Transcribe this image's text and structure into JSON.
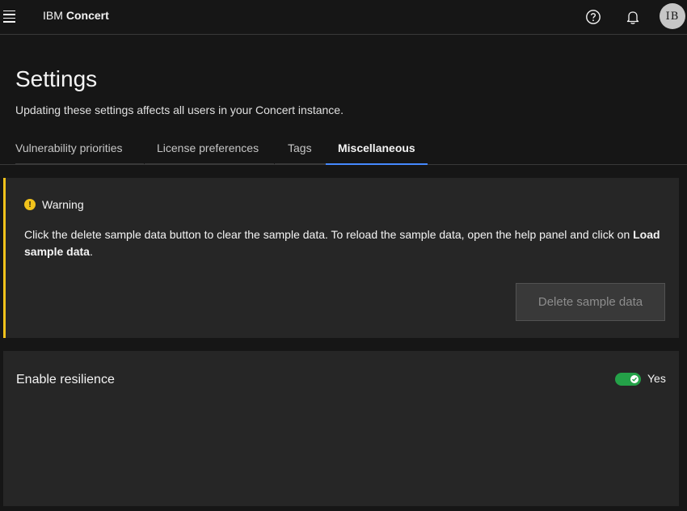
{
  "header": {
    "menu_icon": "hamburger-menu-icon",
    "brand_prefix": "IBM",
    "brand_product": "Concert",
    "help_icon": "help-icon",
    "notification_icon": "bell-icon",
    "avatar_initials": "IB"
  },
  "page": {
    "title": "Settings",
    "subtitle": "Updating these settings affects all users in your Concert instance."
  },
  "tabs": [
    {
      "label": "Vulnerability priorities",
      "active": false
    },
    {
      "label": "License preferences",
      "active": false
    },
    {
      "label": "Tags",
      "active": false
    },
    {
      "label": "Miscellaneous",
      "active": true
    }
  ],
  "warning": {
    "icon": "warning-icon",
    "title": "Warning",
    "text_before": "Click the delete sample data button to clear the sample data. To reload the sample data, open the help panel and click on ",
    "text_bold": "Load sample data",
    "text_after": ".",
    "button_label": "Delete sample data"
  },
  "resilience": {
    "label": "Enable resilience",
    "toggle_on": true,
    "toggle_text": "Yes"
  },
  "colors": {
    "accent": "#4589ff",
    "warning": "#f1c21b",
    "toggle_on": "#24a148",
    "background": "#161616",
    "card": "#262626"
  }
}
